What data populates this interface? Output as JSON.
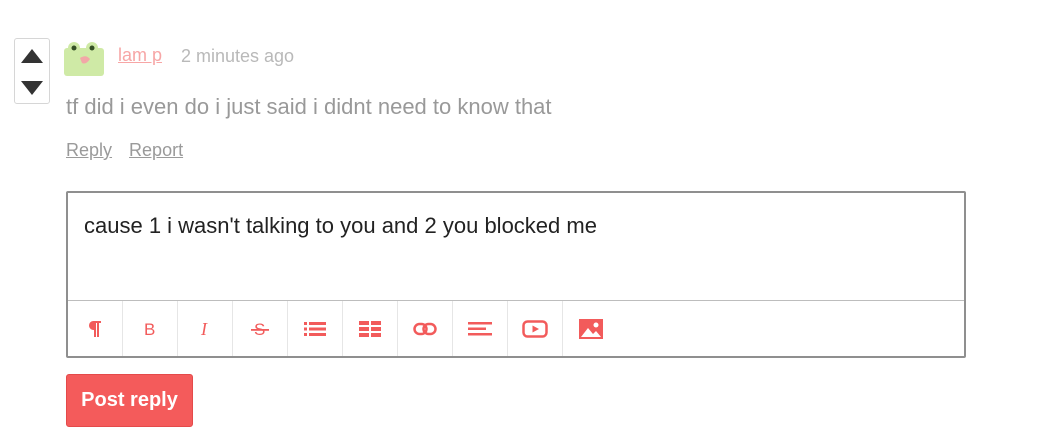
{
  "vote": {
    "up_icon": "triangle-up-icon",
    "down_icon": "triangle-down-icon"
  },
  "comment": {
    "avatar_icon": "frog-avatar-icon",
    "author": "lam p",
    "time": "2 minutes ago",
    "body": "tf did i even do i just said i didnt need to know that",
    "actions": {
      "reply_label": "Reply",
      "report_label": "Report"
    }
  },
  "reply_editor": {
    "value": "cause 1 i wasn't talking to you and 2 you blocked me",
    "toolbar": [
      {
        "name": "paragraph-icon"
      },
      {
        "name": "bold-icon"
      },
      {
        "name": "italic-icon"
      },
      {
        "name": "strikethrough-icon"
      },
      {
        "name": "bullet-list-icon"
      },
      {
        "name": "table-icon"
      },
      {
        "name": "link-icon"
      },
      {
        "name": "align-left-icon"
      },
      {
        "name": "youtube-icon"
      },
      {
        "name": "image-icon"
      }
    ],
    "accent_color": "#f25b5b"
  },
  "post_button": {
    "label": "Post reply",
    "color": "#f45b5b"
  }
}
